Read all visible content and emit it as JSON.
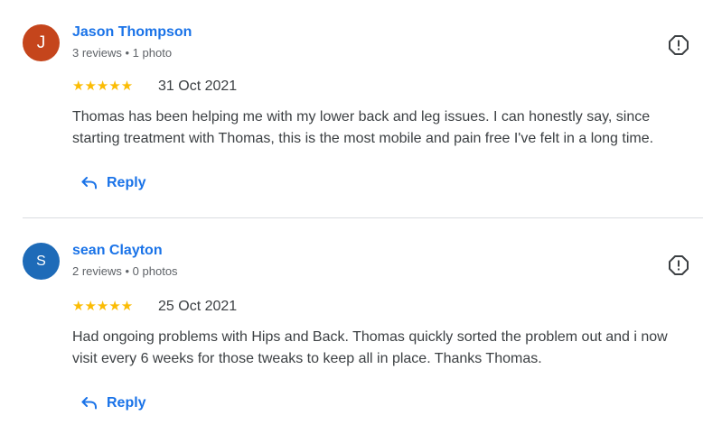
{
  "reviews": [
    {
      "avatar_letter": "J",
      "avatar_color": "#c5451c",
      "author": "Jason Thompson",
      "meta": "3 reviews • 1 photo",
      "rating": 5,
      "stars": "★★★★★",
      "date": "31 Oct 2021",
      "text_line1": "Thomas has been helping me with my lower back and leg issues. I can honestly say, since",
      "text_line2": "starting treatment with Thomas, this is the most mobile and pain free I've felt in a long time.",
      "reply_label": "Reply",
      "flag_icon": "report-flag-icon"
    },
    {
      "avatar_letter": "S",
      "avatar_color": "#1e6bb8",
      "author": "sean Clayton",
      "meta": "2 reviews • 0 photos",
      "rating": 5,
      "stars": "★★★★★",
      "date": "25 Oct 2021",
      "text_line1": "Had ongoing problems with Hips and Back. Thomas quickly sorted the problem out and i now",
      "text_line2": "visit every 6 weeks for those tweaks to keep all in place. Thanks Thomas.",
      "reply_label": "Reply",
      "flag_icon": "report-flag-icon"
    }
  ],
  "colors": {
    "link": "#1a73e8",
    "star": "#fbbc04",
    "text": "#3c4043",
    "meta": "#5f6368",
    "divider": "#dadce0"
  }
}
